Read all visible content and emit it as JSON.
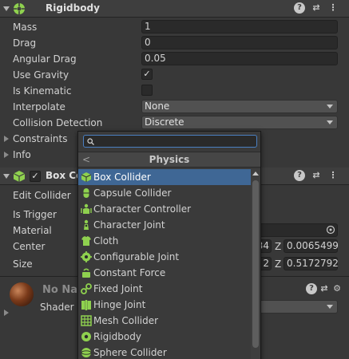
{
  "rigidbody": {
    "title": "Rigidbody",
    "mass_label": "Mass",
    "mass_value": "1",
    "drag_label": "Drag",
    "drag_value": "0",
    "angular_drag_label": "Angular Drag",
    "angular_drag_value": "0.05",
    "use_gravity_label": "Use Gravity",
    "use_gravity_check": "✓",
    "is_kinematic_label": "Is Kinematic",
    "interpolate_label": "Interpolate",
    "interpolate_value": "None",
    "collision_label": "Collision Detection",
    "collision_value": "Discrete",
    "constraints_label": "Constraints",
    "info_label": "Info"
  },
  "box_collider": {
    "title": "Box Co",
    "enabled_check": "✓",
    "edit_collider_label": "Edit Collider",
    "is_trigger_label": "Is Trigger",
    "material_label": "Material",
    "center_label": "Center",
    "center_y_partial": "34",
    "center_z_label": "Z",
    "center_z_value": "0.0065499",
    "size_label": "Size",
    "size_y_partial": "2",
    "size_z_label": "Z",
    "size_z_value": "0.5172792"
  },
  "material_section": {
    "name_partial": "No Nar",
    "shader_label": "Shader"
  },
  "header_icons": {
    "help": "?",
    "presets": "⇄",
    "menu": "⋮"
  },
  "popup": {
    "search_value": "",
    "back_arrow": "<",
    "category_title": "Physics",
    "items": [
      {
        "label": "Box Collider",
        "icon": "box-collider-icon",
        "selected": true
      },
      {
        "label": "Capsule Collider",
        "icon": "capsule-collider-icon"
      },
      {
        "label": "Character Controller",
        "icon": "character-controller-icon"
      },
      {
        "label": "Character Joint",
        "icon": "character-joint-icon"
      },
      {
        "label": "Cloth",
        "icon": "cloth-icon"
      },
      {
        "label": "Configurable Joint",
        "icon": "configurable-joint-icon"
      },
      {
        "label": "Constant Force",
        "icon": "constant-force-icon"
      },
      {
        "label": "Fixed Joint",
        "icon": "fixed-joint-icon"
      },
      {
        "label": "Hinge Joint",
        "icon": "hinge-joint-icon"
      },
      {
        "label": "Mesh Collider",
        "icon": "mesh-collider-icon"
      },
      {
        "label": "Rigidbody",
        "icon": "rigidbody-icon"
      },
      {
        "label": "Sphere Collider",
        "icon": "sphere-collider-icon"
      }
    ]
  },
  "colors": {
    "accent_green": "#8fd14f",
    "selection_blue": "#3f6795",
    "panel_bg": "#383838"
  }
}
